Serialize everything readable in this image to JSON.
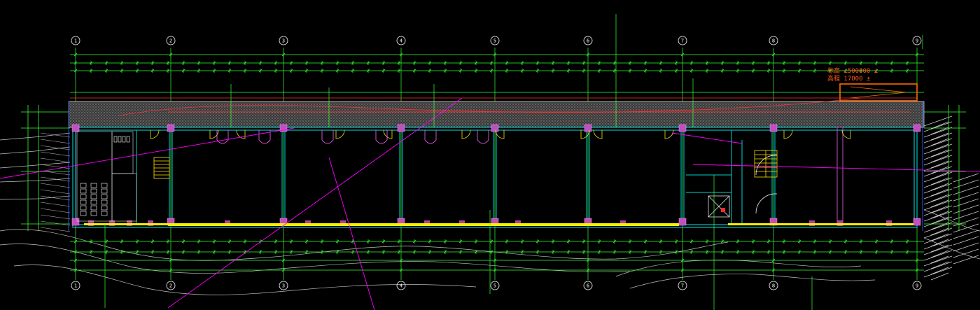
{
  "axes": [
    "1",
    "2",
    "3",
    "4",
    "5",
    "6",
    "7",
    "8",
    "9"
  ],
  "elevation_note": {
    "line1": "标高 ±500000 ±",
    "line2": "高程 17000 ±"
  },
  "colors": {
    "background": "#000000",
    "dimension": "#33ff33",
    "wall": "#00d0d0",
    "column": "#c050c0",
    "corridor_band": "#8a8a8a",
    "window_strip": "#ffee00",
    "guide_line": "#ff00ff",
    "red_note": "#ff5a1a",
    "door": "#ffe000",
    "text": "#ffffff",
    "frame_blue": "#3060ff"
  }
}
